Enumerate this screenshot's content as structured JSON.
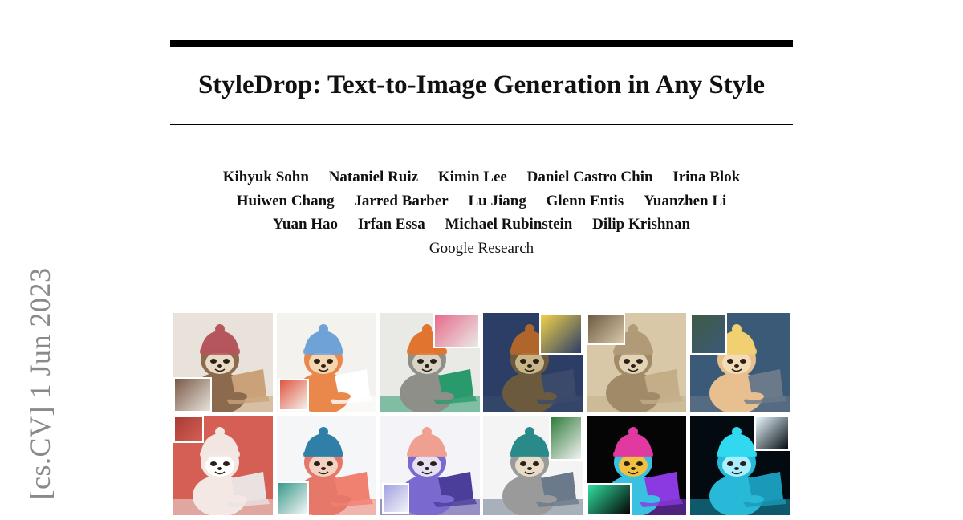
{
  "paper": {
    "title": "StyleDrop: Text-to-Image Generation in Any Style",
    "author_lines": [
      [
        "Kihyuk Sohn",
        "Nataniel Ruiz",
        "Kimin Lee",
        "Daniel Castro Chin",
        "Irina Blok"
      ],
      [
        "Huiwen Chang",
        "Jarred Barber",
        "Lu Jiang",
        "Glenn Entis",
        "Yuanzhen Li"
      ],
      [
        "Yuan Hao",
        "Irfan Essa",
        "Michael Rubinstein",
        "Dilip Krishnan"
      ]
    ],
    "affiliation": "Google Research",
    "arxiv_stamp": "[cs.CV]  1 Jun 2023"
  },
  "figure": {
    "tiles": [
      {
        "bg": "#e8e2da",
        "hat": "#b5555c",
        "body": "#8b6a4e",
        "face": "#eadbc6",
        "prop": "#c9a27a",
        "inset": "#7a5a48"
      },
      {
        "bg": "#f4f2ee",
        "hat": "#6fa3d8",
        "body": "#e9884a",
        "face": "#f4d6b0",
        "prop": "#ffffff",
        "inset": "#e0563f"
      },
      {
        "bg": "#e9e9e6",
        "hat": "#e1742e",
        "body": "#8f8f8a",
        "face": "#d9d4c6",
        "prop": "#2a9a6c",
        "inset": "#e86a8a"
      },
      {
        "bg": "#2c3e66",
        "hat": "#b0662a",
        "body": "#6b5a3e",
        "face": "#c8b58a",
        "prop": "#3b4a6a",
        "inset": "#f2d24a"
      },
      {
        "bg": "#d8c8a8",
        "hat": "#b09a78",
        "body": "#a08a68",
        "face": "#e2d4b4",
        "prop": "#c4ae88",
        "inset": "#6c5a42"
      },
      {
        "bg": "#3a5a78",
        "hat": "#f0d070",
        "body": "#e8c090",
        "face": "#f3dcb8",
        "prop": "#6a7a8a",
        "inset": "#405a44"
      },
      {
        "bg": "#d55f55",
        "hat": "#f2e6e2",
        "body": "#f3e8e4",
        "face": "#ffffff",
        "prop": "#e9e2e0",
        "inset": "#a83c36"
      },
      {
        "bg": "#f4f6f8",
        "hat": "#2f7fa8",
        "body": "#e57868",
        "face": "#f4d2c2",
        "prop": "#f08070",
        "inset": "#3a9a8a"
      },
      {
        "bg": "#f3f3f8",
        "hat": "#f0a090",
        "body": "#7a6ad0",
        "face": "#e6e0f4",
        "prop": "#4a3e9a",
        "inset": "#a0a0e0"
      },
      {
        "bg": "#f3f4f3",
        "hat": "#2a8a8a",
        "body": "#9a9a9a",
        "face": "#e8dcc8",
        "prop": "#6a7a8a",
        "inset": "#2f7a3a"
      },
      {
        "bg": "#050505",
        "hat": "#e03aa0",
        "body": "#3ac0e0",
        "face": "#f0c040",
        "prop": "#8a3ae0",
        "inset": "#30e0a0"
      },
      {
        "bg": "#030a10",
        "hat": "#30d8f0",
        "body": "#28b8d8",
        "face": "#a8f0ff",
        "prop": "#1a9ab8",
        "inset": "#e8f8ff"
      }
    ]
  }
}
